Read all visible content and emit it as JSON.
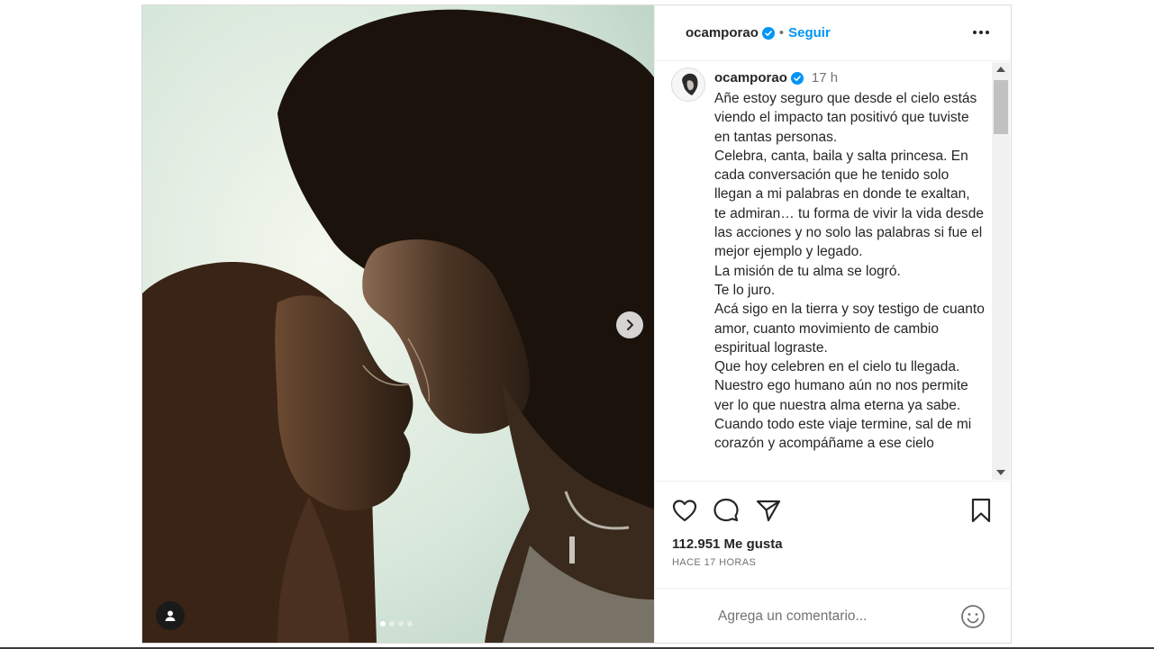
{
  "post": {
    "username": "ocamporao",
    "verified": true,
    "follow_label": "Seguir",
    "separator": "•"
  },
  "media": {
    "slides": 4,
    "active_slide": 1
  },
  "caption": {
    "username": "ocamporao",
    "time": "17 h",
    "text": "Añe estoy seguro que desde el cielo estás viendo el impacto tan positivó que tuviste en tantas personas.\nCelebra, canta, baila y salta princesa. En cada conversación que he tenido solo llegan a mi palabras en donde te exaltan, te admiran… tu forma de vivir la vida desde las acciones y no solo las palabras si fue el mejor ejemplo y legado.\nLa misión de tu alma se logró.\nTe lo juro.\nAcá sigo en la tierra y soy testigo de cuanto amor, cuanto movimiento de cambio espiritual lograste.\nQue hoy celebren en el cielo tu llegada.\nNuestro ego humano aún no nos permite ver lo que nuestra alma eterna ya sabe.\nCuando todo este viaje termine, sal de mi corazón y acompáñame a ese cielo"
  },
  "stats": {
    "likes": "112.951 Me gusta",
    "posted_ago": "HACE 17 HORAS"
  },
  "comment": {
    "placeholder": "Agrega un comentario..."
  },
  "icons": {
    "more": "more-horizontal-icon",
    "like": "heart-icon",
    "comment": "comment-bubble-icon",
    "share": "paper-plane-icon",
    "save": "bookmark-icon",
    "next": "chevron-right-icon",
    "tag": "user-tag-icon",
    "emoji": "smiley-icon"
  },
  "colors": {
    "accent": "#0095f6",
    "verified": "#0095f6",
    "text": "#262626",
    "muted": "#737373"
  }
}
